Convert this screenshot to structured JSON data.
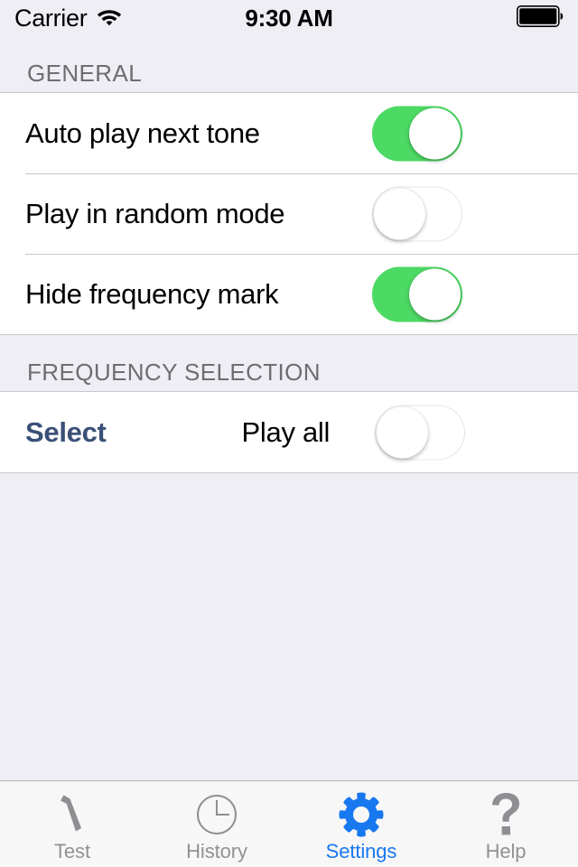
{
  "status_bar": {
    "carrier": "Carrier",
    "wifi_icon": "wifi-icon",
    "time": "9:30 AM",
    "battery_icon": "battery-full-icon"
  },
  "sections": [
    {
      "header": "GENERAL",
      "rows": [
        {
          "label": "Auto play next tone",
          "control": "toggle",
          "state": "on"
        },
        {
          "label": "Play in random mode",
          "control": "toggle",
          "state": "off"
        },
        {
          "label": "Hide frequency mark",
          "control": "toggle",
          "state": "on"
        }
      ]
    },
    {
      "header": "FREQUENCY SELECTION",
      "rows": [
        {
          "label": "Select",
          "secondary_label": "Play all",
          "control": "toggle",
          "state": "off"
        }
      ]
    }
  ],
  "tab_bar": {
    "items": [
      {
        "label": "Test",
        "icon": "tuning-fork-icon",
        "active": false
      },
      {
        "label": "History",
        "icon": "clock-icon",
        "active": false
      },
      {
        "label": "Settings",
        "icon": "gear-icon",
        "active": true
      },
      {
        "label": "Help",
        "icon": "question-mark-icon",
        "active": false
      }
    ]
  },
  "colors": {
    "toggle_on": "#4CD964",
    "accent_blue": "#1878F0",
    "select_link": "#3A5077",
    "group_background": "#EFEEF4",
    "separator": "#C8C7CC",
    "header_text": "#6D6D72",
    "tab_inactive": "#929292"
  }
}
